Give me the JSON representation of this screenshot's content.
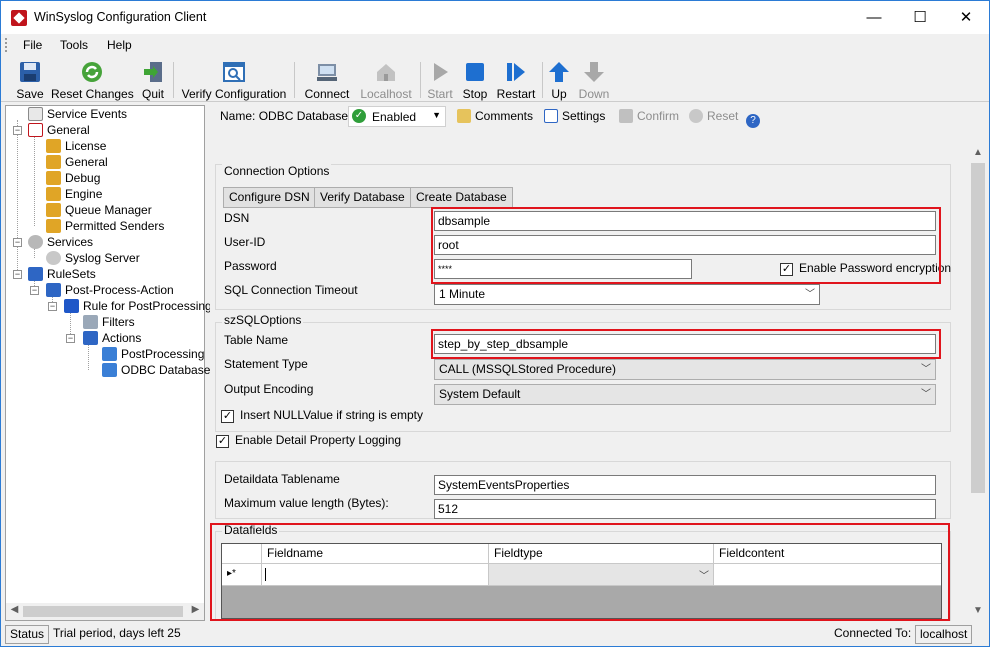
{
  "window": {
    "title": "WinSyslog Configuration Client",
    "min": "—",
    "max": "☐",
    "close": "✕"
  },
  "menu": [
    "File",
    "Tools",
    "Help"
  ],
  "toolbar": {
    "save": "Save",
    "reset_changes": "Reset Changes",
    "quit": "Quit",
    "verify_configuration": "Verify Configuration",
    "connect": "Connect",
    "localhost": "Localhost",
    "start": "Start",
    "stop": "Stop",
    "restart": "Restart",
    "up": "Up",
    "down": "Down"
  },
  "tree": {
    "service_events": "Service Events",
    "general": "General",
    "license": "License",
    "general_child": "General",
    "debug": "Debug",
    "engine": "Engine",
    "queue_manager": "Queue Manager",
    "permitted_senders": "Permitted Senders",
    "services": "Services",
    "syslog_server": "Syslog Server",
    "rulesets": "RuleSets",
    "post_process_action": "Post-Process-Action",
    "rule_for_postprocessing": "Rule for PostProcessing",
    "filters": "Filters",
    "actions": "Actions",
    "postprocessing": "PostProcessing",
    "odbc_database": "ODBC Database"
  },
  "rtoolbar": {
    "name_label": "Name:",
    "name_value": "ODBC Database",
    "enabled": "Enabled",
    "comments": "Comments",
    "settings": "Settings",
    "confirm": "Confirm",
    "reset": "Reset"
  },
  "connection": {
    "group": "Connection Options",
    "configure_dsn": "Configure DSN",
    "verify_database": "Verify Database",
    "create_database": "Create Database",
    "dsn_label": "DSN",
    "dsn_value": "dbsample",
    "userid_label": "User-ID",
    "userid_value": "root",
    "password_label": "Password",
    "password_value": "****",
    "enable_encryption": "Enable Password encryption",
    "enable_encryption_checked": true,
    "timeout_label": "SQL Connection Timeout",
    "timeout_value": "1 Minute"
  },
  "sql": {
    "group": "szSQLOptions",
    "table_label": "Table Name",
    "table_value": "step_by_step_dbsample",
    "statement_label": "Statement Type",
    "statement_value": "CALL (MSSQLStored Procedure)",
    "encoding_label": "Output Encoding",
    "encoding_value": "System Default",
    "insert_null": "Insert NULLValue if string is empty",
    "insert_null_checked": true
  },
  "detail_logging": {
    "label": "Enable Detail Property Logging",
    "checked": true
  },
  "detail": {
    "tablename_label": "Detaildata Tablename",
    "tablename_value": "SystemEventsProperties",
    "maxlen_label": "Maximum value length (Bytes):",
    "maxlen_value": "512"
  },
  "datafields": {
    "group": "Datafields",
    "columns": [
      "Fieldname",
      "Fieldtype",
      "Fieldcontent"
    ],
    "new_row_marker": "▸*"
  },
  "status": {
    "status": "Status",
    "trial": "Trial period, days left 25",
    "connected_to": "Connected To:",
    "host": "localhost"
  },
  "colors": {
    "highlight_red": "#e0141c",
    "accent_blue": "#1e6fd0"
  }
}
